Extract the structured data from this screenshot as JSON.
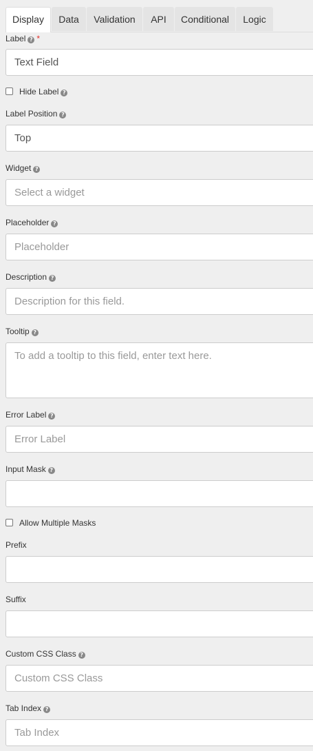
{
  "tabs": [
    "Display",
    "Data",
    "Validation",
    "API",
    "Conditional",
    "Logic"
  ],
  "label": {
    "title": "Label",
    "required": "*",
    "value": "Text Field"
  },
  "hide_label": "Hide Label",
  "label_position": {
    "title": "Label Position",
    "value": "Top"
  },
  "widget": {
    "title": "Widget",
    "placeholder": "Select a widget"
  },
  "placeholder": {
    "title": "Placeholder",
    "placeholder": "Placeholder"
  },
  "description": {
    "title": "Description",
    "placeholder": "Description for this field."
  },
  "tooltip": {
    "title": "Tooltip",
    "placeholder": "To add a tooltip to this field, enter text here."
  },
  "error_label": {
    "title": "Error Label",
    "placeholder": "Error Label"
  },
  "input_mask": {
    "title": "Input Mask",
    "value": ""
  },
  "allow_multiple_masks": "Allow Multiple Masks",
  "prefix": {
    "title": "Prefix",
    "value": ""
  },
  "suffix": {
    "title": "Suffix",
    "value": ""
  },
  "custom_css": {
    "title": "Custom CSS Class",
    "placeholder": "Custom CSS Class"
  },
  "tab_index": {
    "title": "Tab Index",
    "placeholder": "Tab Index"
  },
  "help_icon_glyph": "?",
  "colors": {
    "required": "#e3302a",
    "background": "#efefef",
    "border": "#cccccc",
    "placeholder": "#999999"
  }
}
